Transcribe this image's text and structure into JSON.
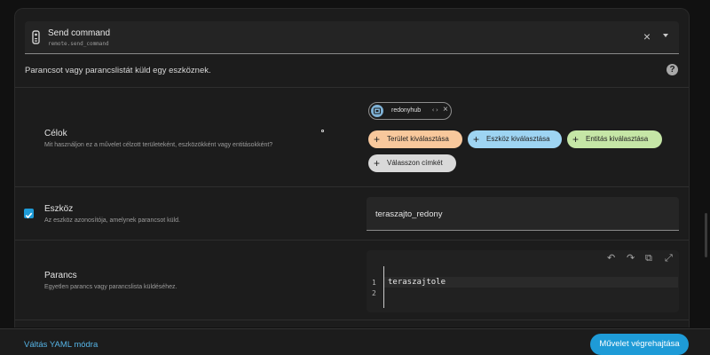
{
  "service": {
    "title": "Send command",
    "id": "remote.send_command",
    "icon": "remote-icon",
    "clear_glyph": "×"
  },
  "description": "Parancsot vagy parancslistát küld egy eszköznek.",
  "help_glyph": "?",
  "targets": {
    "title": "Célok",
    "subtitle": "Mit használjon ez a művelet célzott területeként, eszközökként vagy entitásokként?",
    "selected_device": {
      "label": "redonyhub",
      "code_glyph": "‹›",
      "remove_glyph": "×",
      "icon": "device-icon"
    },
    "buttons": [
      {
        "label": "Terület kiválasztása",
        "color": "#f8c89c"
      },
      {
        "label": "Eszköz kiválasztása",
        "color": "#9ed4f2"
      },
      {
        "label": "Entitás kiválasztása",
        "color": "#c5e6a6"
      },
      {
        "label": "Válasszon címkét",
        "color": "#d9d9d9"
      }
    ]
  },
  "device_field": {
    "title": "Eszköz",
    "subtitle": "Az eszköz azonosítója, amelynek parancsot küld.",
    "value": "teraszajto_redony",
    "checked": true
  },
  "command_field": {
    "title": "Parancs",
    "subtitle": "Egyetlen parancs vagy parancslista küldéséhez.",
    "lines": [
      "1",
      "2"
    ],
    "code": "teraszajtole"
  },
  "editor_tools": {
    "undo": "↶",
    "redo": "↷",
    "copy": "⧉",
    "expand": "⤢"
  },
  "footer": {
    "yaml_link": "Váltás YAML módra",
    "run_button": "Művelet végrehajtása"
  },
  "colors": {
    "accent": "#1e9bd7",
    "background": "#1c1c1c"
  }
}
